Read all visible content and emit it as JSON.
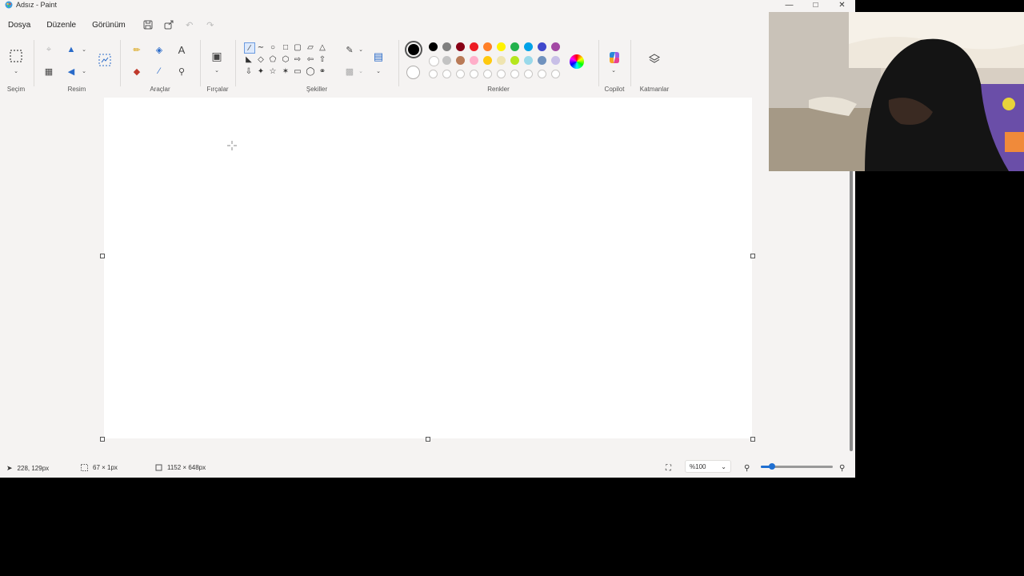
{
  "window": {
    "title": "Adsız - Paint"
  },
  "menu": {
    "items": [
      "Dosya",
      "Düzenle",
      "Görünüm"
    ]
  },
  "ribbon": {
    "groups": {
      "selection": "Seçim",
      "image": "Resim",
      "tools": "Araçlar",
      "brushes": "Fırçalar",
      "shapes": "Şekiller",
      "colors": "Renkler",
      "copilot": "Copilot",
      "layers": "Katmanlar"
    },
    "active_color": "#000000",
    "secondary_color": "#ffffff",
    "palette_row1": [
      "#000000",
      "#7f7f7f",
      "#880015",
      "#ed1c24",
      "#ff7f27",
      "#fff200",
      "#22b14c",
      "#00a2e8",
      "#3f48cc",
      "#a349a4"
    ],
    "palette_row2": [
      "#ffffff",
      "#c3c3c3",
      "#b97a57",
      "#ffaec9",
      "#ffc90e",
      "#efe4b0",
      "#b5e61d",
      "#99d9ea",
      "#7092be",
      "#c8bfe7"
    ]
  },
  "status": {
    "cursor_pos": "228, 129px",
    "selection_size": "67 × 1px",
    "canvas_size": "1152 × 648px",
    "zoom": "%100",
    "zoom_level": 0.15
  }
}
